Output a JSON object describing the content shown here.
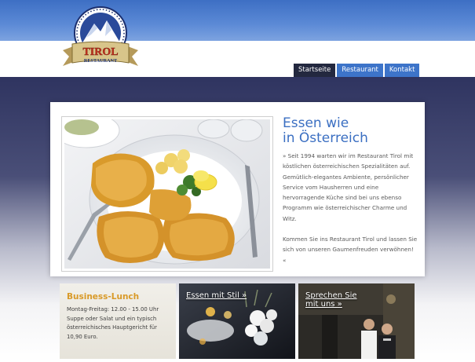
{
  "logo": {
    "brand": "TIROL",
    "sub": "RESTAURANT"
  },
  "nav": [
    {
      "label": "Startseite",
      "active": true
    },
    {
      "label": "Restaurant",
      "active": false
    },
    {
      "label": "Kontakt",
      "active": false
    }
  ],
  "main": {
    "headline_line1": "Essen wie",
    "headline_line2": "in Österreich",
    "paragraph1": "» Seit 1994 warten wir im Restaurant Tirol mit köstlichen österreichischen Spezialitäten auf. Gemütlich-elegantes Ambiente, persönlicher Service vom Hausherren und eine hervorragende Küche sind bei uns ebenso Programm wie österreichischer Charme und Witz.",
    "paragraph2": "Kommen Sie ins Restaurant Tirol und lassen Sie sich von unseren Gaumenfreuden verwöhnen! «"
  },
  "boxes": {
    "lunch_title": "Business-Lunch",
    "lunch_text": "Montag-Freitag: 12.00 - 15.00 Uhr Suppe oder Salat und ein typisch österreichisches Hauptgericht für 10,90 Euro.",
    "stil_link": "Essen mit Stil »",
    "sprechen_line1": "Sprechen Sie",
    "sprechen_line2": "mit uns »"
  },
  "colors": {
    "accent_blue": "#3b6fc2",
    "nav_active": "#23283f",
    "lunch_title": "#d99a28"
  }
}
